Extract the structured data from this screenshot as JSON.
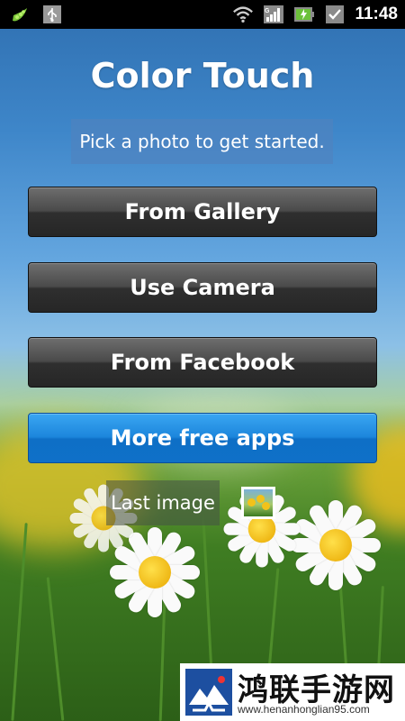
{
  "status_bar": {
    "time": "11:48",
    "left_icons": [
      "pea-pod-icon",
      "usb-icon"
    ],
    "right_icons": [
      "wifi-icon",
      "signal-icon",
      "battery-charging-icon",
      "notification-check-icon"
    ]
  },
  "app": {
    "title": "Color Touch",
    "subtitle": "Pick a photo to get started."
  },
  "buttons": {
    "gallery": "From Gallery",
    "camera": "Use Camera",
    "facebook": "From Facebook",
    "more_apps": "More free apps"
  },
  "last_image": {
    "label": "Last image"
  },
  "watermark": {
    "name": "鸿联手游网",
    "url": "www.henanhonglian95.com"
  },
  "colors": {
    "button_dark": "#3a3a3a",
    "button_blue": "#1c86dc",
    "status_bar": "#000000"
  }
}
